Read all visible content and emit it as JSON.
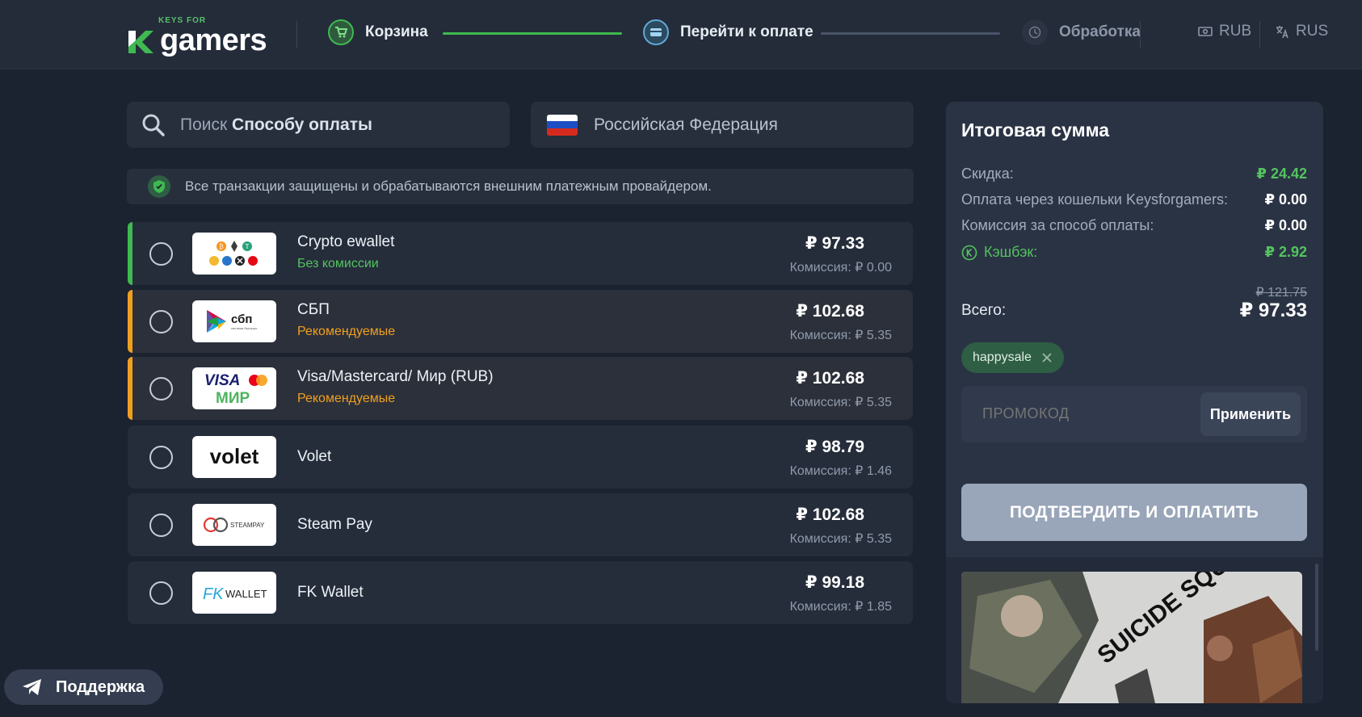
{
  "header": {
    "logo_small": "KEYS FOR",
    "logo_text": "gamers",
    "steps": [
      {
        "label": "Корзина",
        "icon": "cart-icon",
        "state": "done"
      },
      {
        "label": "Перейти к оплате",
        "icon": "card-icon",
        "state": "active"
      },
      {
        "label": "Обработка",
        "icon": "clock-icon",
        "state": "pending"
      }
    ],
    "currency": "RUB",
    "language": "RUS"
  },
  "search": {
    "prefix": "Поиск",
    "bold": "Способу оплаты"
  },
  "country": {
    "name": "Российская Федерация"
  },
  "notice": {
    "text": "Все транзакции защищены и обрабатываются внешним платежным провайдером."
  },
  "payment_methods": [
    {
      "name": "Crypto ewallet",
      "tag": "Без комиссии",
      "tag_color": "#53c35f",
      "accent": "#3fb950",
      "price": "₽ 97.33",
      "fee": "Комиссия: ₽ 0.00",
      "logo": "crypto-logo"
    },
    {
      "name": "СБП",
      "tag": "Рекомендуемые",
      "tag_color": "#f0a020",
      "accent": "#f0a020",
      "price": "₽ 102.68",
      "fee": "Комиссия: ₽ 5.35",
      "logo": "sbp-logo"
    },
    {
      "name": "Visa/Mastercard/ Мир (RUB)",
      "tag": "Рекомендуемые",
      "tag_color": "#f0a020",
      "accent": "#f0a020",
      "price": "₽ 102.68",
      "fee": "Комиссия: ₽ 5.35",
      "logo": "visa-mir-logo"
    },
    {
      "name": "Volet",
      "tag": "",
      "price": "₽ 98.79",
      "fee": "Комиссия: ₽ 1.46",
      "logo": "volet-logo"
    },
    {
      "name": "Steam Pay",
      "tag": "",
      "price": "₽ 102.68",
      "fee": "Комиссия: ₽ 5.35",
      "logo": "steampay-logo"
    },
    {
      "name": "FK Wallet",
      "tag": "",
      "price": "₽ 99.18",
      "fee": "Комиссия: ₽ 1.85",
      "logo": "fkwallet-logo"
    }
  ],
  "summary": {
    "title": "Итоговая сумма",
    "discount_label": "Скидка:",
    "discount_value": "₽ 24.42",
    "wallet_label": "Оплата через кошельки Keysforgamers:",
    "wallet_value": "₽ 0.00",
    "fee_label": "Комиссия за способ оплаты:",
    "fee_value": "₽ 0.00",
    "cashback_label": "Кэшбэк:",
    "cashback_value": "₽ 2.92",
    "old_total": "₽ 121.75",
    "total_label": "Всего:",
    "total_value": "₽ 97.33",
    "promo_chip": "happysale",
    "promo_placeholder": "ПРОМОКОД",
    "apply_label": "Применить",
    "confirm_label": "ПОДТВЕРДИТЬ И ОПЛАТИТЬ"
  },
  "game": {
    "title_art": "SUICIDE SQUAD"
  },
  "support": {
    "label": "Поддержка"
  },
  "colors": {
    "accent_green": "#3fb950",
    "accent_orange": "#f0a020",
    "background": "#1b2230"
  }
}
